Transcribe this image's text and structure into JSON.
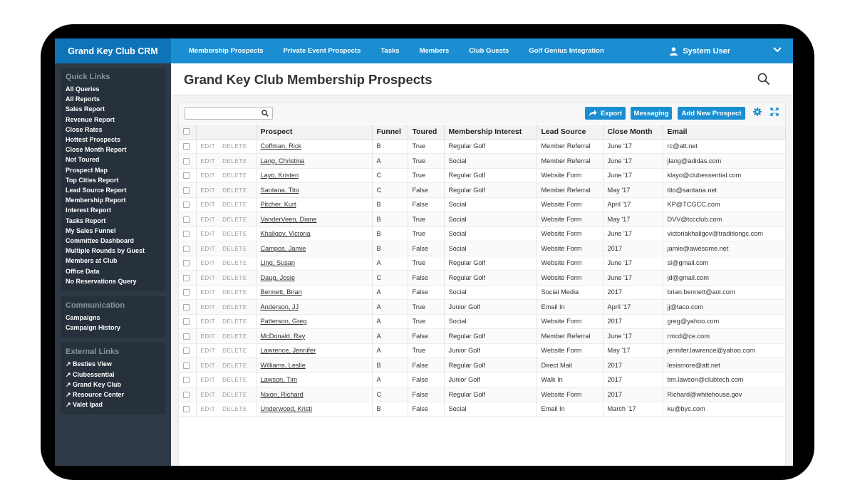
{
  "app": {
    "brand": "Grand Key Club CRM"
  },
  "nav": [
    "Membership Prospects",
    "Private Event Prospects",
    "Tasks",
    "Members",
    "Club Guests",
    "Golf Genius Integration"
  ],
  "user": {
    "name": "System User"
  },
  "page": {
    "title": "Grand Key Club Membership Prospects"
  },
  "sidebar": {
    "quick_links": {
      "title": "Quick Links",
      "items": [
        "All Queries",
        "All Reports",
        "Sales Report",
        "Revenue Report",
        "Close Rates",
        "Hottest Prospects",
        "Close Month Report",
        "Not Toured",
        "Prospect Map",
        "Top Cities Report",
        "Lead Source Report",
        "Membership Report",
        "Interest Report",
        "Tasks Report",
        "My Sales Funnel",
        "Committee Dashboard",
        "Multiple Rounds by Guest",
        "Members at Club",
        "Office Data",
        "No Reservations Query"
      ]
    },
    "communication": {
      "title": "Communication",
      "items": [
        "Campaigns",
        "Campaign History"
      ]
    },
    "external_links": {
      "title": "External Links",
      "items": [
        "↗ Besties View",
        "↗ Clubessential",
        "↗ Grand Key Club",
        "↗ Resource Center",
        "↗ Valet Ipad"
      ]
    }
  },
  "toolbar": {
    "search_placeholder": "",
    "export": "Export",
    "messaging": "Messaging",
    "add": "Add New Prospect"
  },
  "table": {
    "edit_label": "EDIT",
    "delete_label": "DELETE",
    "columns": [
      "Prospect",
      "Funnel",
      "Toured",
      "Membership Interest",
      "Lead Source",
      "Close Month",
      "Email"
    ],
    "rows": [
      [
        "Coffman, Rick",
        "B",
        "True",
        "Regular Golf",
        "Member Referral",
        "June '17",
        "rc@att.net"
      ],
      [
        "Lang, Christina",
        "A",
        "True",
        "Social",
        "Member Referral",
        "June '17",
        "jlang@adidas.com"
      ],
      [
        "Layo, Kristen",
        "C",
        "True",
        "Regular Golf",
        "Website Form",
        "June '17",
        "klayo@clubessential.com"
      ],
      [
        "Santana, Tito",
        "C",
        "False",
        "Regular Golf",
        "Member Referral",
        "May '17",
        "tito@santana.net"
      ],
      [
        "Pitcher, Kurt",
        "B",
        "False",
        "Social",
        "Website Form",
        "April '17",
        "KP@TCGCC.com"
      ],
      [
        "VanderVeen, Diane",
        "B",
        "True",
        "Social",
        "Website Form",
        "May '17",
        "DVV@tccclub.com"
      ],
      [
        "Khaligov, Victoria",
        "B",
        "True",
        "Social",
        "Website Form",
        "June '17",
        "victoriakhaligov@traditiongc.com"
      ],
      [
        "Campos, Jamie",
        "B",
        "False",
        "Social",
        "Website Form",
        "2017",
        "jamie@awesome.net"
      ],
      [
        "Ling, Susan",
        "A",
        "True",
        "Regular Golf",
        "Website Form",
        "June '17",
        "sl@gmail.com"
      ],
      [
        "Daug, Josie",
        "C",
        "False",
        "Regular Golf",
        "Website Form",
        "June '17",
        "jd@gmail.com"
      ],
      [
        "Bennett, Brian",
        "A",
        "False",
        "Social",
        "Social Media",
        "2017",
        "brian.bennett@aol.com"
      ],
      [
        "Anderson, JJ",
        "A",
        "True",
        "Junior Golf",
        "Email In",
        "April '17",
        "jj@taco.com"
      ],
      [
        "Patterson, Greg",
        "A",
        "True",
        "Social",
        "Website Form",
        "2017",
        "greg@yahoo.com"
      ],
      [
        "McDonald, Ray",
        "A",
        "False",
        "Regular Golf",
        "Member Referral",
        "June '17",
        "rmcd@ce.com"
      ],
      [
        "Lawrence, Jennifer",
        "A",
        "True",
        "Junior Golf",
        "Website Form",
        "May '17",
        "jennifer.lawrence@yahoo.com"
      ],
      [
        "Williams, Leslie",
        "B",
        "False",
        "Regular Golf",
        "Direct Mail",
        "2017",
        "lesismore@att.net"
      ],
      [
        "Lawson, Tim",
        "A",
        "False",
        "Junior Golf",
        "Walk In",
        "2017",
        "tim.lawson@clubtech.com"
      ],
      [
        "Nixon, Richard",
        "C",
        "False",
        "Regular Golf",
        "Website Form",
        "2017",
        "Richard@whitehouse.gov"
      ],
      [
        "Underwood, Kristi",
        "B",
        "False",
        "Social",
        "Email In",
        "March '17",
        "ku@byc.com"
      ]
    ]
  },
  "icons": {
    "user": "user-icon",
    "chevron": "chevron-down-icon",
    "search": "search-icon",
    "export": "share-icon",
    "gear": "gear-icon",
    "expand": "expand-icon"
  },
  "colors": {
    "nav_blue": "#1a8ed1",
    "brand_blue": "#0f73b8",
    "sidebar": "#2e3a46"
  }
}
